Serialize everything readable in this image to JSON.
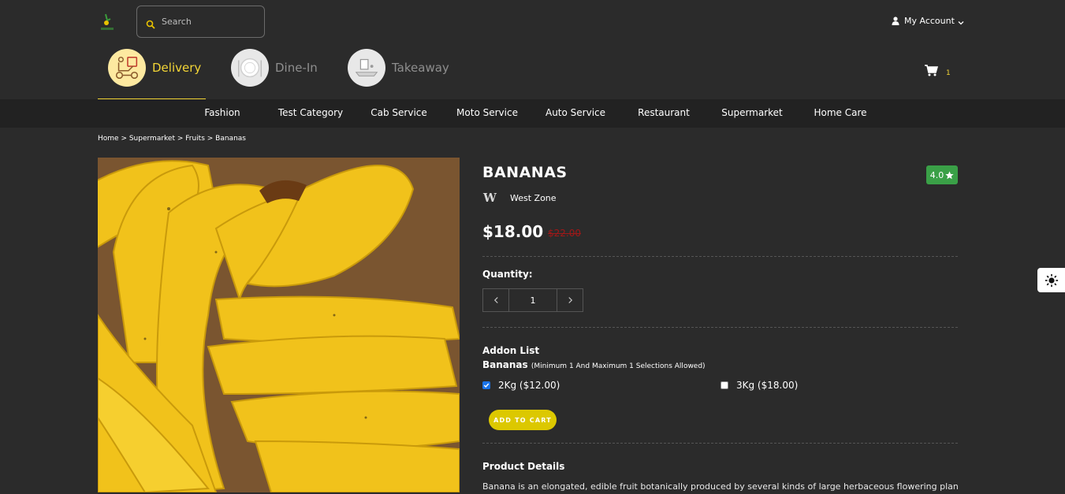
{
  "header": {
    "search_placeholder": "Search",
    "account_label": "My Account",
    "cart_count": "1"
  },
  "service_tabs": [
    {
      "label": "Delivery",
      "icon": "delivery-scooter-icon",
      "active": true
    },
    {
      "label": "Dine-In",
      "icon": "plate-icon",
      "active": false
    },
    {
      "label": "Takeaway",
      "icon": "takeaway-bag-icon",
      "active": false
    }
  ],
  "categories": [
    "Fashion",
    "Test Category",
    "Cab Service",
    "Moto Service",
    "Auto Service",
    "Restaurant",
    "Supermarket",
    "Home Care"
  ],
  "breadcrumb": {
    "text": "Home > Supermarket > Fruits > Bananas"
  },
  "product": {
    "name": "BANANAS",
    "rating": "4.0",
    "store": "West Zone",
    "price": "$18.00",
    "old_price": "$22.00",
    "quantity_label": "Quantity:",
    "quantity": "1",
    "addon_title": "Addon List",
    "addon_group": "Bananas",
    "addon_rule": "(Minimum 1 And Maximum 1 Selections Allowed)",
    "options": [
      {
        "label": "2Kg ($12.00)",
        "checked": true
      },
      {
        "label": "3Kg ($18.00)",
        "checked": false
      }
    ],
    "add_to_cart": "ADD TO CART",
    "details_title": "Product Details",
    "details_text": "Banana is an elongated, edible fruit  botanically  produced by several kinds of large herbaceous flowering plants in the genus"
  },
  "colors": {
    "accent": "#f3d536",
    "background": "#2b2b2b",
    "category_bar": "#222222",
    "rating_green": "#3aa047",
    "old_price_red": "#a01818"
  }
}
